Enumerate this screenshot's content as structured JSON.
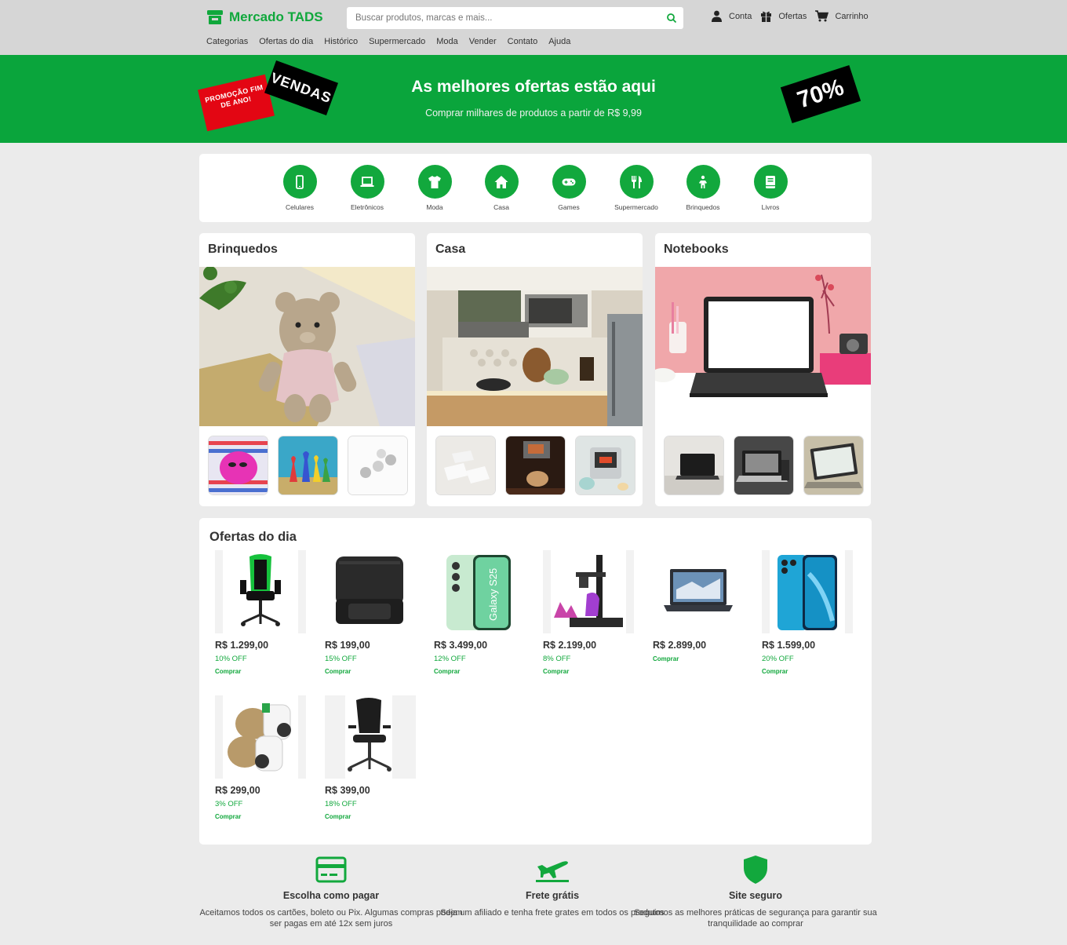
{
  "brand": {
    "name": "Mercado TADS",
    "accent": "#10a83c"
  },
  "search": {
    "placeholder": "Buscar produtos, marcas e mais..."
  },
  "header_actions": [
    {
      "label": "Conta",
      "icon": "user-icon"
    },
    {
      "label": "Ofertas",
      "icon": "gift-icon"
    },
    {
      "label": "Carrinho",
      "icon": "cart-icon"
    }
  ],
  "nav": [
    "Categorias",
    "Ofertas do dia",
    "Histórico",
    "Supermercado",
    "Moda",
    "Vender",
    "Contato",
    "Ajuda"
  ],
  "banner": {
    "title": "As melhores ofertas estão aqui",
    "subtitle": "Comprar milhares de produtos a partir de R$ 9,99",
    "tag_red": "PROMOÇÃO FIM DE ANO!",
    "tag_black": "VENDAS",
    "tag_pct": "70%"
  },
  "categories": [
    {
      "label": "Celulares",
      "icon": "phone-icon"
    },
    {
      "label": "Eletrônicos",
      "icon": "laptop-icon"
    },
    {
      "label": "Moda",
      "icon": "shirt-icon"
    },
    {
      "label": "Casa",
      "icon": "house-icon"
    },
    {
      "label": "Games",
      "icon": "gamepad-icon"
    },
    {
      "label": "Supermercado",
      "icon": "utensils-icon"
    },
    {
      "label": "Brinquedos",
      "icon": "child-icon"
    },
    {
      "label": "Livros",
      "icon": "book-icon"
    }
  ],
  "sections": [
    {
      "title": "Brinquedos"
    },
    {
      "title": "Casa"
    },
    {
      "title": "Notebooks"
    }
  ],
  "offers": {
    "title": "Ofertas do dia",
    "items": [
      {
        "price": "R$ 1.299,00",
        "discount": "10% OFF",
        "buy": "Comprar"
      },
      {
        "price": "R$ 199,00",
        "discount": "15% OFF",
        "buy": "Comprar"
      },
      {
        "price": "R$ 3.499,00",
        "discount": "12% OFF",
        "buy": "Comprar"
      },
      {
        "price": "R$ 2.199,00",
        "discount": "8% OFF",
        "buy": "Comprar"
      },
      {
        "price": "R$ 2.899,00",
        "discount": "",
        "buy": "Comprar"
      },
      {
        "price": "R$ 1.599,00",
        "discount": "20% OFF",
        "buy": "Comprar"
      },
      {
        "price": "R$ 299,00",
        "discount": "3% OFF",
        "buy": "Comprar"
      },
      {
        "price": "R$ 399,00",
        "discount": "18% OFF",
        "buy": "Comprar"
      }
    ]
  },
  "features": [
    {
      "title": "Escolha como pagar",
      "text": "Aceitamos todos os cartões, boleto ou Pix. Algumas compras podem ser pagas em até 12x sem juros",
      "icon": "credit-card-icon"
    },
    {
      "title": "Frete grátis",
      "text": "Seja um afiliado e tenha frete grates em todos os produtos",
      "icon": "plane-icon"
    },
    {
      "title": "Site seguro",
      "text": "Seguimos as melhores práticas de segurança para garantir sua tranquilidade ao comprar",
      "icon": "shield-icon"
    }
  ]
}
